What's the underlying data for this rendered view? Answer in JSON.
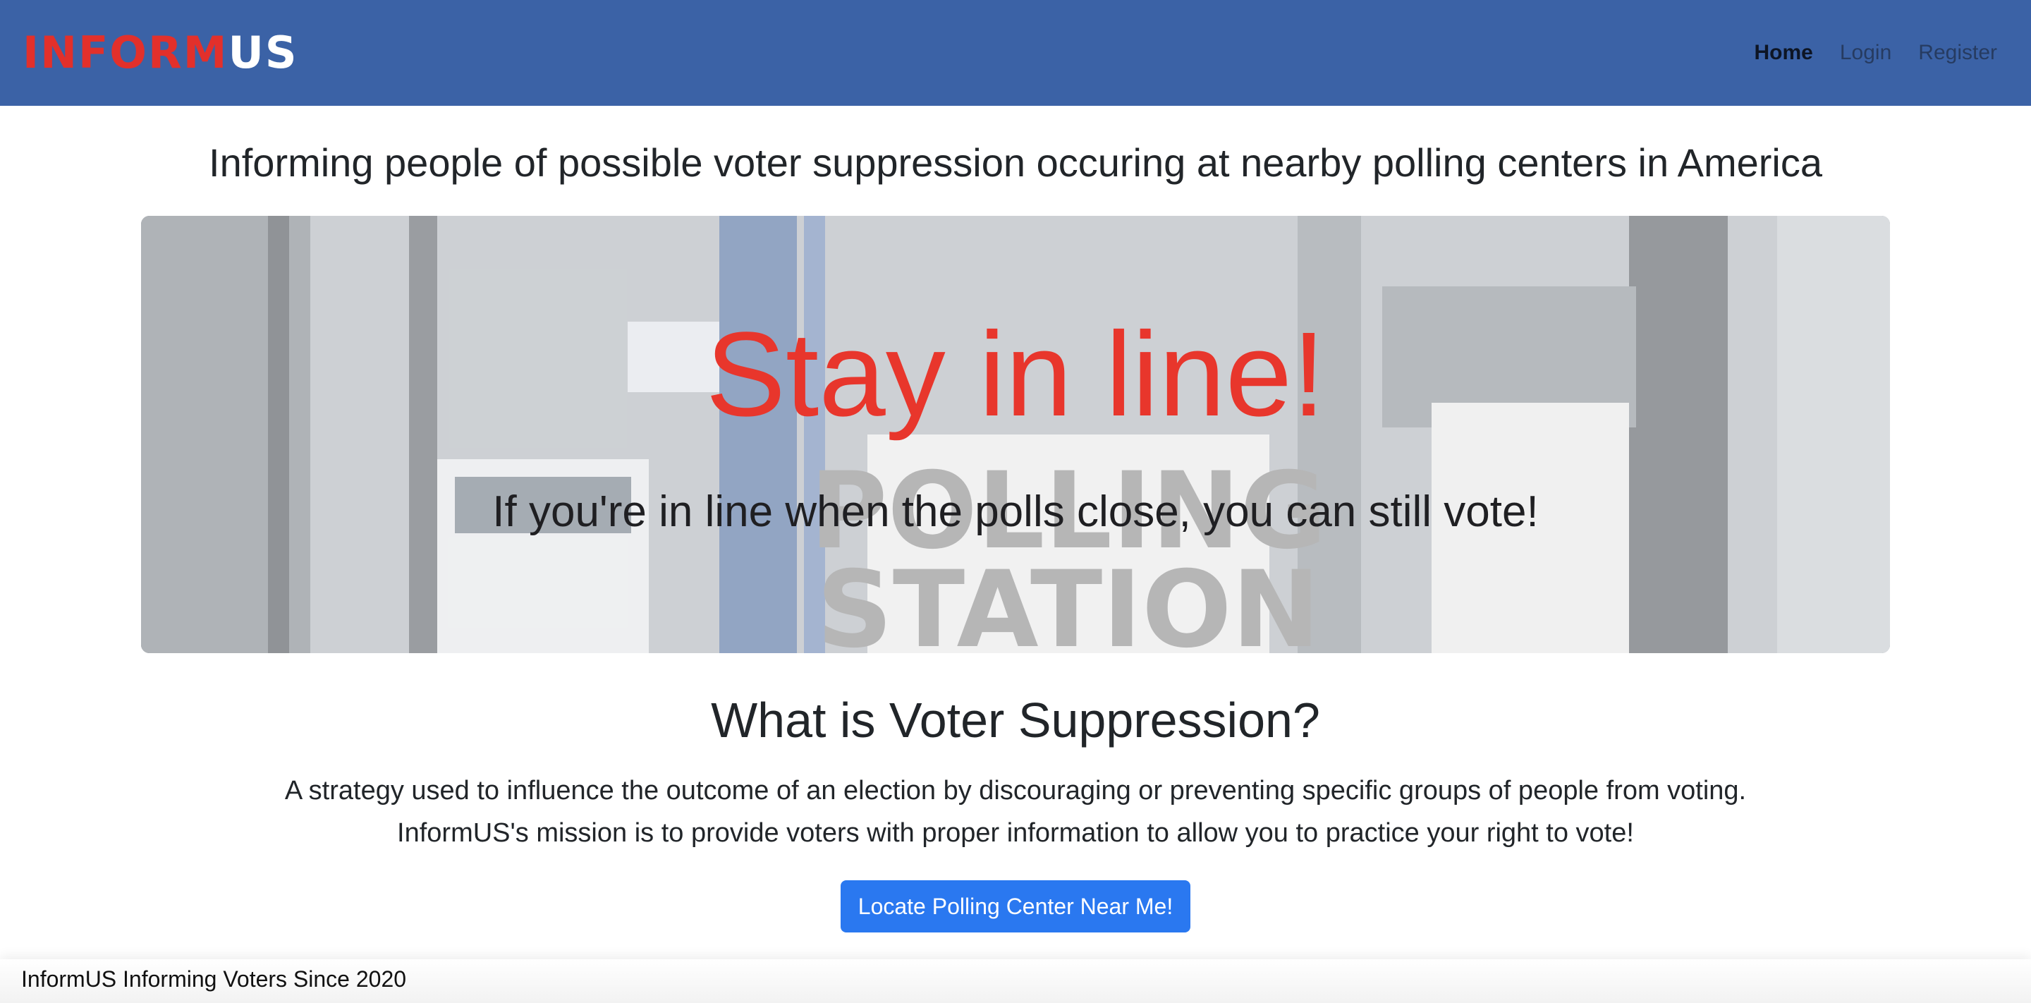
{
  "brand": {
    "part1": "INFORM",
    "part2": "US"
  },
  "nav": {
    "home": "Home",
    "login": "Login",
    "register": "Register"
  },
  "headline": "Informing people of possible voter suppression occuring at nearby polling centers in America",
  "hero": {
    "title": "Stay in line!",
    "subtitle": "If you're in line when the polls close, you can still vote!"
  },
  "section": {
    "title": "What is Voter Suppression?",
    "line1": "A strategy used to influence the outcome of an election by discouraging or preventing specific groups of people from voting.",
    "line2": "InformUS's mission is to provide voters with proper information to allow you to practice your right to vote!"
  },
  "cta": {
    "label": "Locate Polling Center Near Me!"
  },
  "footer": {
    "text": "InformUS Informing Voters Since 2020"
  },
  "colors": {
    "navbar": "#3b62a6",
    "brand_red": "#e2302b",
    "hero_title": "#e8362c",
    "button": "#2a78f0"
  }
}
